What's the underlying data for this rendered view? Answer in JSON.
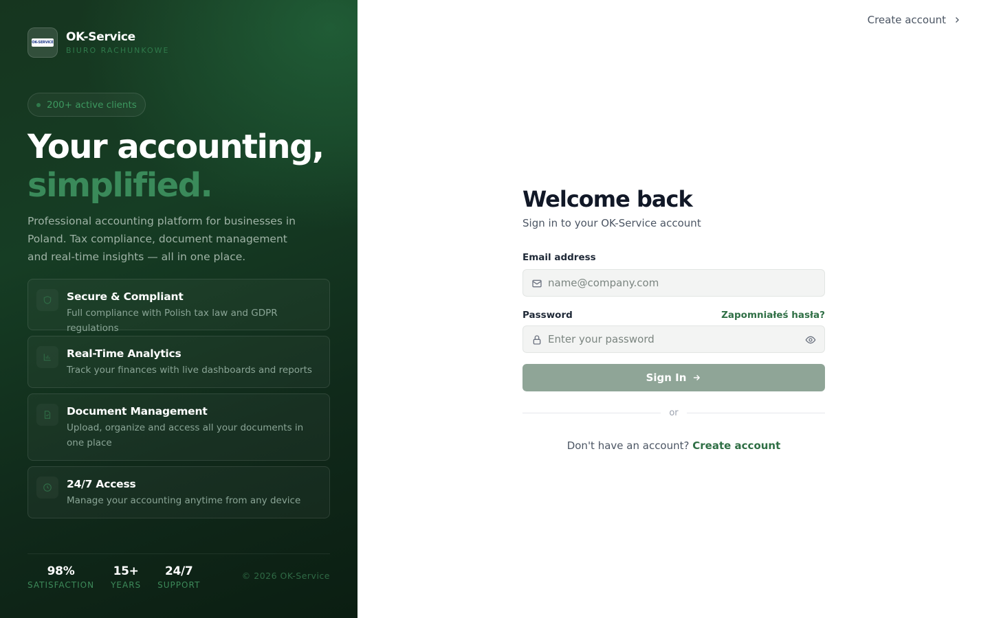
{
  "brand": {
    "name": "OK-Service",
    "subtitle": "BIURO RACHUNKOWE",
    "logo_text": "OK-SERVICE"
  },
  "hero": {
    "badge": "200+ active clients",
    "title_line1": "Your accounting,",
    "title_line2": "simplified.",
    "description": "Professional accounting platform for businesses in Poland. Tax compliance, document management and real-time insights — all in one place."
  },
  "features": [
    {
      "icon": "shield-icon",
      "title": "Secure & Compliant",
      "text": "Full compliance with Polish tax law and GDPR regulations"
    },
    {
      "icon": "bar-chart-icon",
      "title": "Real-Time Analytics",
      "text": "Track your finances with live dashboards and reports"
    },
    {
      "icon": "document-icon",
      "title": "Document Management",
      "text": "Upload, organize and access all your documents in one place"
    },
    {
      "icon": "clock-icon",
      "title": "24/7 Access",
      "text": "Manage your accounting anytime from any device"
    }
  ],
  "stats": [
    {
      "value": "98%",
      "label": "SATISFACTION"
    },
    {
      "value": "15+",
      "label": "YEARS"
    },
    {
      "value": "24/7",
      "label": "SUPPORT"
    }
  ],
  "copyright": "© 2026 OK-Service",
  "header": {
    "create_account_link": "Create account"
  },
  "form": {
    "title": "Welcome back",
    "subtitle": "Sign in to your OK-Service account",
    "email_label": "Email address",
    "email_placeholder": "name@company.com",
    "email_value": "",
    "password_label": "Password",
    "forgot_link": "Zapomniałeś hasła?",
    "password_placeholder": "Enter your password",
    "password_value": "",
    "submit_label": "Sign In",
    "divider_text": "or",
    "signup_prompt": "Don't have an account?",
    "signup_link": "Create account"
  },
  "colors": {
    "left_panel_bg": "#163d24",
    "accent_green": "#2f6f45",
    "hero_green": "#3a8a5a",
    "button_disabled": "#8fa597"
  }
}
